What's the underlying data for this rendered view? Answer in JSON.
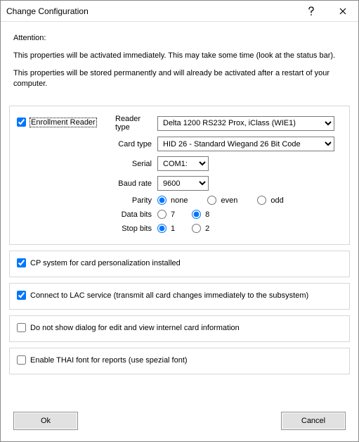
{
  "window": {
    "title": "Change Configuration"
  },
  "attention": {
    "heading": "Attention:",
    "line1": "This properties will be activated immediately. This may take some time (look at the status bar).",
    "line2": "This properties will be stored permanently and will already be activated after a restart of your computer."
  },
  "reader": {
    "enroll_label": "Enrollment Reader",
    "reader_type_label": "Reader type",
    "reader_type_value": "Delta 1200 RS232 Prox, iClass (WIE1)",
    "card_type_label": "Card type",
    "card_type_value": "HID 26 - Standard Wiegand 26 Bit Code",
    "serial_label": "Serial",
    "serial_value": "COM1:",
    "baud_label": "Baud rate",
    "baud_value": "9600",
    "parity_label": "Parity",
    "parity_none": "none",
    "parity_even": "even",
    "parity_odd": "odd",
    "databits_label": "Data bits",
    "databits_7": "7",
    "databits_8": "8",
    "stopbits_label": "Stop bits",
    "stopbits_1": "1",
    "stopbits_2": "2"
  },
  "options": {
    "cp_system": "CP system for card personalization installed",
    "lac": "Connect to LAC service (transmit all card changes  immediately to the subsystem)",
    "hide_dialog": "Do not show dialog for edit and view internel card information",
    "thai_font": "Enable THAI font for reports (use spezial font)"
  },
  "buttons": {
    "ok": "Ok",
    "cancel": "Cancel"
  }
}
